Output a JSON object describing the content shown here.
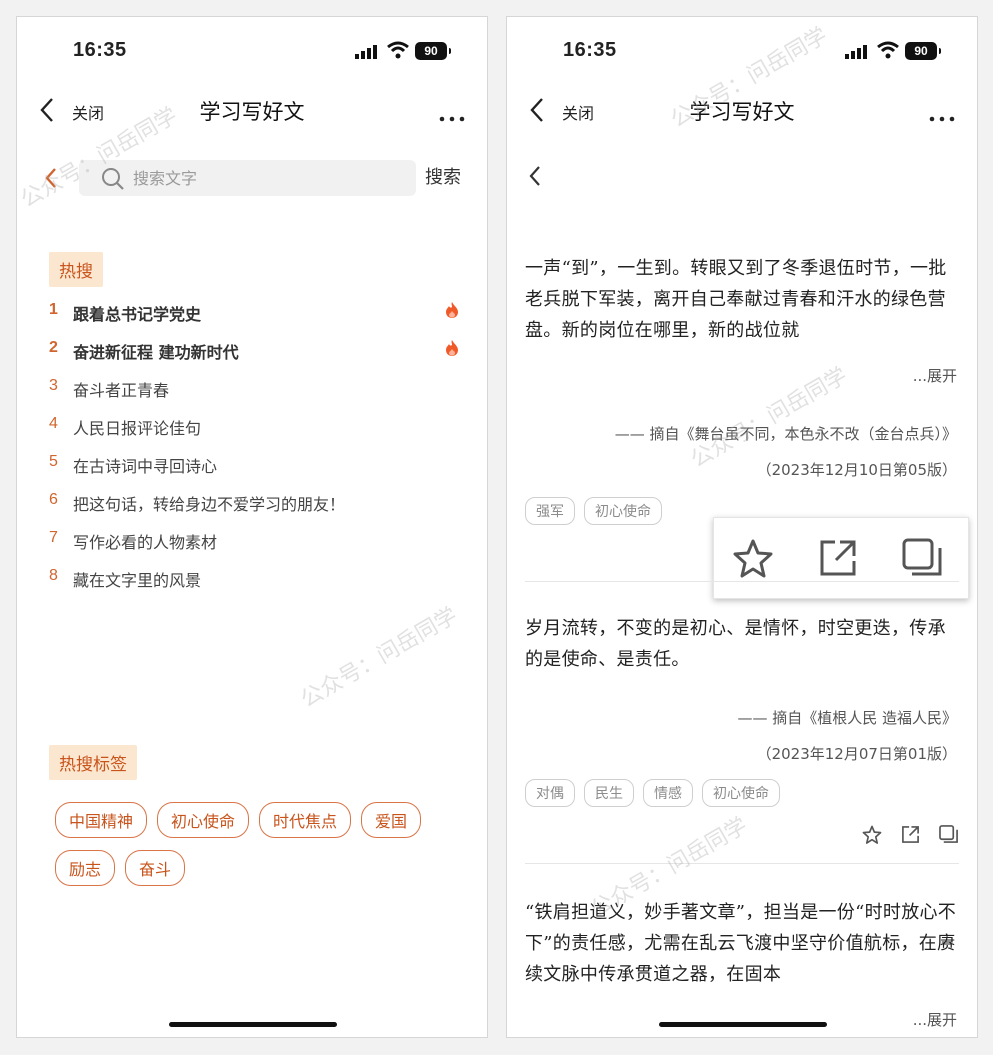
{
  "status_bar": {
    "time": "16:35",
    "battery": "90"
  },
  "nav": {
    "close_label": "关闭",
    "title": "学习写好文"
  },
  "search": {
    "placeholder": "搜索文字",
    "button_label": "搜索"
  },
  "hot_search": {
    "label": "热搜",
    "items": [
      {
        "rank": "1",
        "text": "跟着总书记学党史",
        "hot": true
      },
      {
        "rank": "2",
        "text": "奋进新征程 建功新时代",
        "hot": true
      },
      {
        "rank": "3",
        "text": "奋斗者正青春",
        "hot": false
      },
      {
        "rank": "4",
        "text": "人民日报评论佳句",
        "hot": false
      },
      {
        "rank": "5",
        "text": "在古诗词中寻回诗心",
        "hot": false
      },
      {
        "rank": "6",
        "text": "把这句话，转给身边不爱学习的朋友！",
        "hot": false
      },
      {
        "rank": "7",
        "text": "写作必看的人物素材",
        "hot": false
      },
      {
        "rank": "8",
        "text": "藏在文字里的风景",
        "hot": false
      }
    ]
  },
  "hot_tags": {
    "label": "热搜标签",
    "tags": [
      "中国精神",
      "初心使命",
      "时代焦点",
      "爱国",
      "励志",
      "奋斗"
    ]
  },
  "articles": [
    {
      "body": "一声“到”，一生到。转眼又到了冬季退伍时节，一批老兵脱下军装，离开自己奉献过青春和汗水的绿色营盘。新的岗位在哪里，新的战位就",
      "expand": "...展开",
      "source": "—— 摘自《舞台虽不同，本色永不改（金台点兵）》",
      "date": "（2023年12月10日第05版）",
      "tags": [
        "强军",
        "初心使命"
      ]
    },
    {
      "body": "岁月流转，不变的是初心、是情怀，时空更迭，传承的是使命、是责任。",
      "source": "—— 摘自《植根人民 造福人民》",
      "date": "（2023年12月07日第01版）",
      "tags": [
        "对偶",
        "民生",
        "情感",
        "初心使命"
      ]
    },
    {
      "body": "“铁肩担道义，妙手著文章”，担当是一份“时时放心不下”的责任感，尤需在乱云飞渡中坚守价值航标，在赓续文脉中传承贯道之器，在固本",
      "expand": "...展开"
    }
  ],
  "watermark": {
    "text": "公众号：问岳同学"
  },
  "colors": {
    "accent": "#d0652f",
    "label_bg": "#fbe7cf",
    "tag_border": "#d97447"
  }
}
